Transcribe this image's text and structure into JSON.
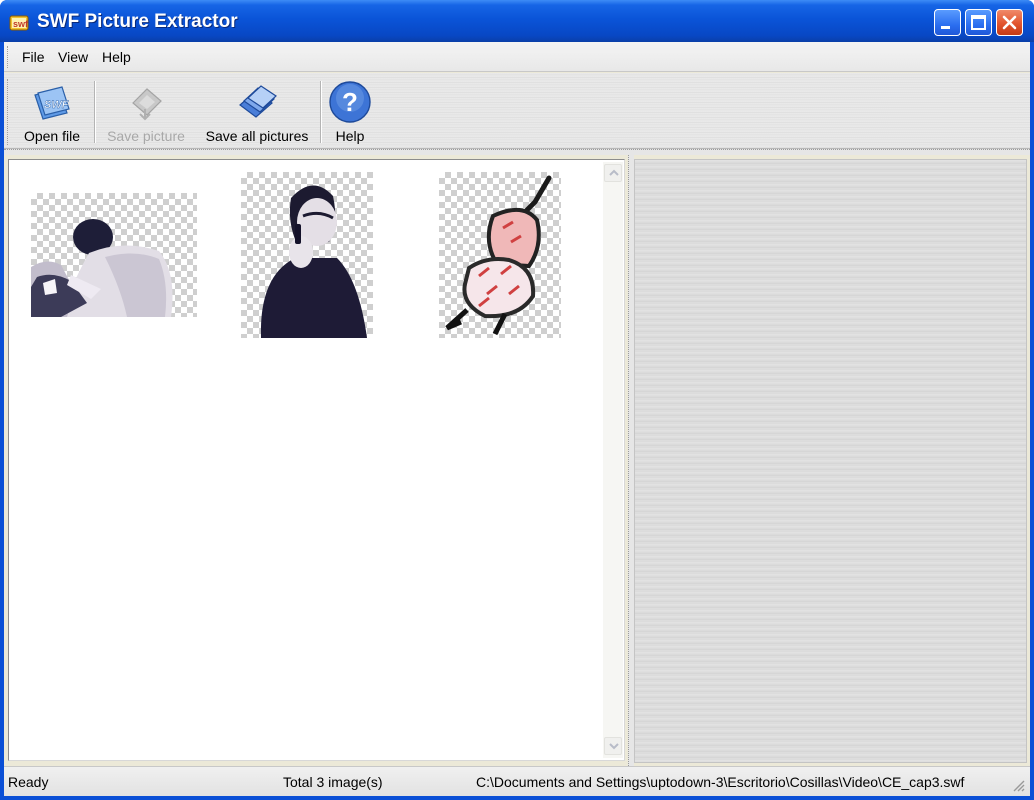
{
  "window": {
    "title": "SWF Picture Extractor",
    "accent_color": "#0a54d8",
    "controls": [
      "minimize-icon",
      "maximize-icon",
      "close-icon"
    ]
  },
  "menu": {
    "items": [
      {
        "label": "File"
      },
      {
        "label": "View"
      },
      {
        "label": "Help"
      }
    ]
  },
  "toolbar": {
    "buttons": [
      {
        "label": "Open file",
        "icon": "open-swf-icon",
        "enabled": true
      },
      {
        "label": "Save picture",
        "icon": "save-picture-icon",
        "enabled": false
      },
      {
        "label": "Save all pictures",
        "icon": "save-all-icon",
        "enabled": true
      },
      {
        "label": "Help",
        "icon": "help-icon",
        "enabled": true
      }
    ]
  },
  "images": {
    "items": [
      {
        "name": "man-working-thumbnail"
      },
      {
        "name": "woman-on-phone-thumbnail"
      },
      {
        "name": "sketch-figure-thumbnail"
      }
    ]
  },
  "status": {
    "state": "Ready",
    "count": "Total 3 image(s)",
    "path": "C:\\Documents and Settings\\uptodown-3\\Escritorio\\Cosillas\\Video\\CE_cap3.swf"
  }
}
